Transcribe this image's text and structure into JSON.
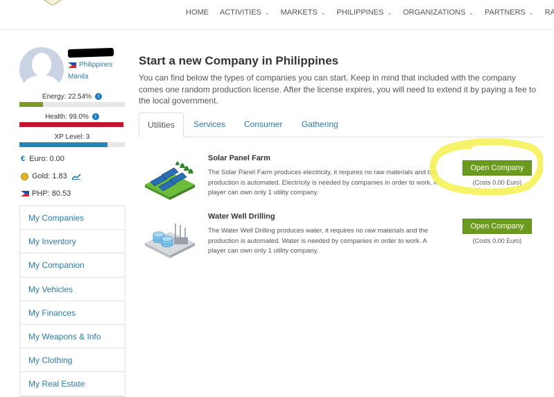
{
  "nav": {
    "items": [
      {
        "label": "HOME",
        "dropdown": false
      },
      {
        "label": "ACTIVITIES",
        "dropdown": true
      },
      {
        "label": "MARKETS",
        "dropdown": true
      },
      {
        "label": "PHILIPPINES",
        "dropdown": true
      },
      {
        "label": "ORGANIZATIONS",
        "dropdown": true
      },
      {
        "label": "PARTNERS",
        "dropdown": true
      },
      {
        "label": "RANKING",
        "dropdown": false
      }
    ]
  },
  "profile": {
    "country": "Philippines",
    "city": "Manila",
    "energy": {
      "label": "Energy: 22.54%",
      "value": 0.2254,
      "color": "#7a9a22"
    },
    "health": {
      "label": "Health: 99.0%",
      "value": 0.99,
      "color": "#c0182a"
    },
    "xp": {
      "label": "XP Level: 3",
      "value": 0.835,
      "color": "#1f88b8"
    },
    "euro": "Euro: 0.00",
    "gold": "Gold: 1.83",
    "php": "PHP: 80.53"
  },
  "menu": [
    "My Companies",
    "My Inventory",
    "My Companion",
    "My Vehicles",
    "My Finances",
    "My Weapons & Info",
    "My Clothing",
    "My Real Estate"
  ],
  "main": {
    "title": "Start a new Company in Philippines",
    "description": "You can find below the types of companies you can start. Keep in mind that included with the company comes one random production license. After the license expires, you will need to extend it by paying a fee to the local government.",
    "tabs": [
      "Utilities",
      "Services",
      "Consumer",
      "Gathering"
    ],
    "active_tab": "Utilities",
    "companies": [
      {
        "name": "Solar Panel Farm",
        "description": "The Solar Panel Farm produces electricity, it requires no raw materials and the production is automated. Electricity is needed by companies in order to work. A player can own only 1 utility company.",
        "button": "Open Company",
        "cost": "(Costs 0.00 Euro)"
      },
      {
        "name": "Water Well Drilling",
        "description": "The Water Well Drilling produces water, it requires no raw materials and the production is automated. Water is needed by companies in order to work. A player can own only 1 utility company.",
        "button": "Open Company",
        "cost": "(Costs 0.00 Euro)"
      }
    ]
  },
  "colors": {
    "accent": "#2a7ab0",
    "button": "#6b9b1e",
    "highlight": "#f5f25a"
  }
}
